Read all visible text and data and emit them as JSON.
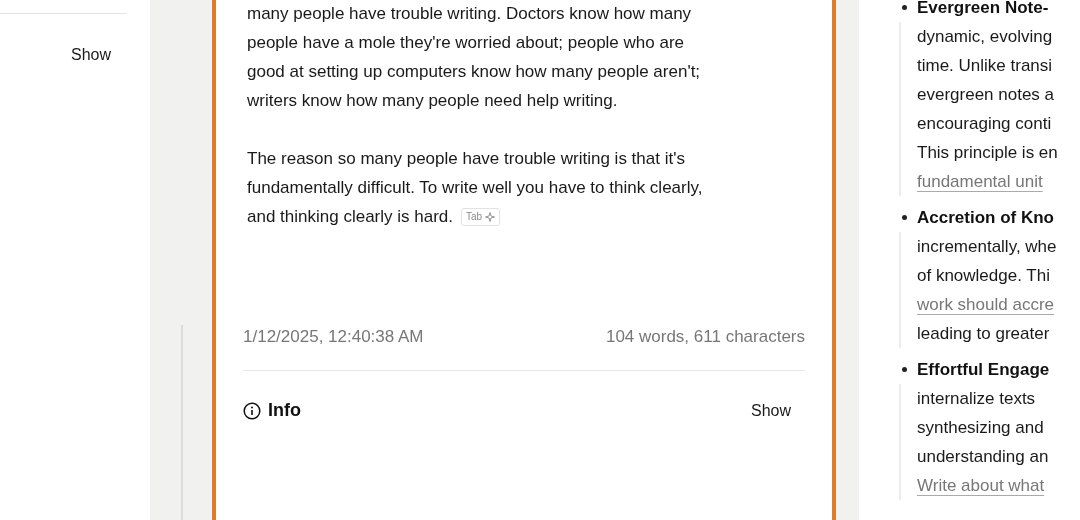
{
  "left_panel": {
    "show_button": "Show"
  },
  "editor": {
    "paragraphs": [
      {
        "lines": [
          "many people have trouble writing. Doctors know how many",
          "people have a mole they're worried about; people who are",
          "good at setting up computers know how many people aren't;",
          "writers know how many people need help writing."
        ]
      },
      {
        "lines": [
          "The reason so many people have trouble writing is that it's",
          "fundamentally difficult. To write well you have to think clearly,",
          "and thinking clearly is hard."
        ]
      }
    ],
    "suggestion_key": "Tab",
    "timestamp": "1/12/2025, 12:40:38 AM",
    "stats": "104 words, 611 characters",
    "info": {
      "title": "Info",
      "show_button": "Show"
    }
  },
  "right_panel": {
    "items": [
      {
        "title": "Evergreen Note-",
        "lines": [
          {
            "text": "dynamic, evolving",
            "link": false
          },
          {
            "text": "time. Unlike transi",
            "link": false
          },
          {
            "text": "evergreen notes a",
            "link": false
          },
          {
            "text": "encouraging conti",
            "link": false
          },
          {
            "text": "This principle is en",
            "link": false
          },
          {
            "text": "fundamental unit",
            "link": true
          }
        ]
      },
      {
        "title": "Accretion of Kno",
        "lines": [
          {
            "text": "incrementally, whe",
            "link": false
          },
          {
            "text": "of knowledge. Thi",
            "link": false
          },
          {
            "text": "work should accre",
            "link": true
          },
          {
            "text": "leading to greater",
            "link": false
          }
        ]
      },
      {
        "title": "Effortful Engage",
        "lines": [
          {
            "text": "internalize texts",
            "link": false
          },
          {
            "text": "synthesizing and",
            "link": false
          },
          {
            "text": "understanding an",
            "link": false
          },
          {
            "text": "Write about what",
            "link": true
          }
        ]
      }
    ]
  }
}
